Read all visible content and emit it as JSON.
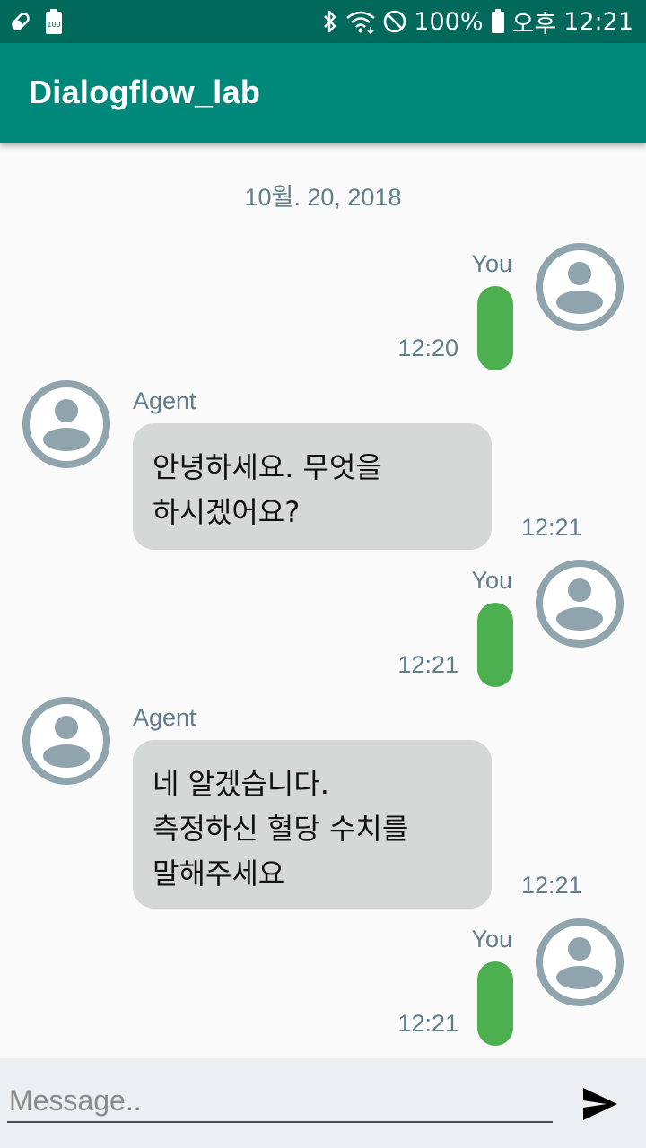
{
  "status_bar": {
    "battery_percent": "100%",
    "time_period": "오후",
    "time": "12:21",
    "left_icons": [
      "pill-icon",
      "battery-100-icon"
    ],
    "right_icons": [
      "bluetooth-icon",
      "wifi-icon",
      "do-not-disturb-icon",
      "battery-icon"
    ]
  },
  "app": {
    "title": "Dialogflow_lab",
    "colors": {
      "status_bar": "#00695c",
      "toolbar": "#00897b",
      "user_bubble": "#4caf50",
      "agent_bubble": "#d6d7d7",
      "meta_text": "#607d8b"
    }
  },
  "chat": {
    "date": "10월. 20, 2018",
    "messages": [
      {
        "sender": "You",
        "time": "12:20",
        "text": ""
      },
      {
        "sender": "Agent",
        "time": "12:21",
        "text": "안녕하세요. 무엇을\n하시겠어요?"
      },
      {
        "sender": "You",
        "time": "12:21",
        "text": ""
      },
      {
        "sender": "Agent",
        "time": "12:21",
        "text": "네 알겠습니다.\n측정하신 혈당 수치를\n말해주세요"
      },
      {
        "sender": "You",
        "time": "12:21",
        "text": ""
      }
    ]
  },
  "composer": {
    "placeholder": "Message..",
    "value": "",
    "send_icon": "send-icon"
  }
}
